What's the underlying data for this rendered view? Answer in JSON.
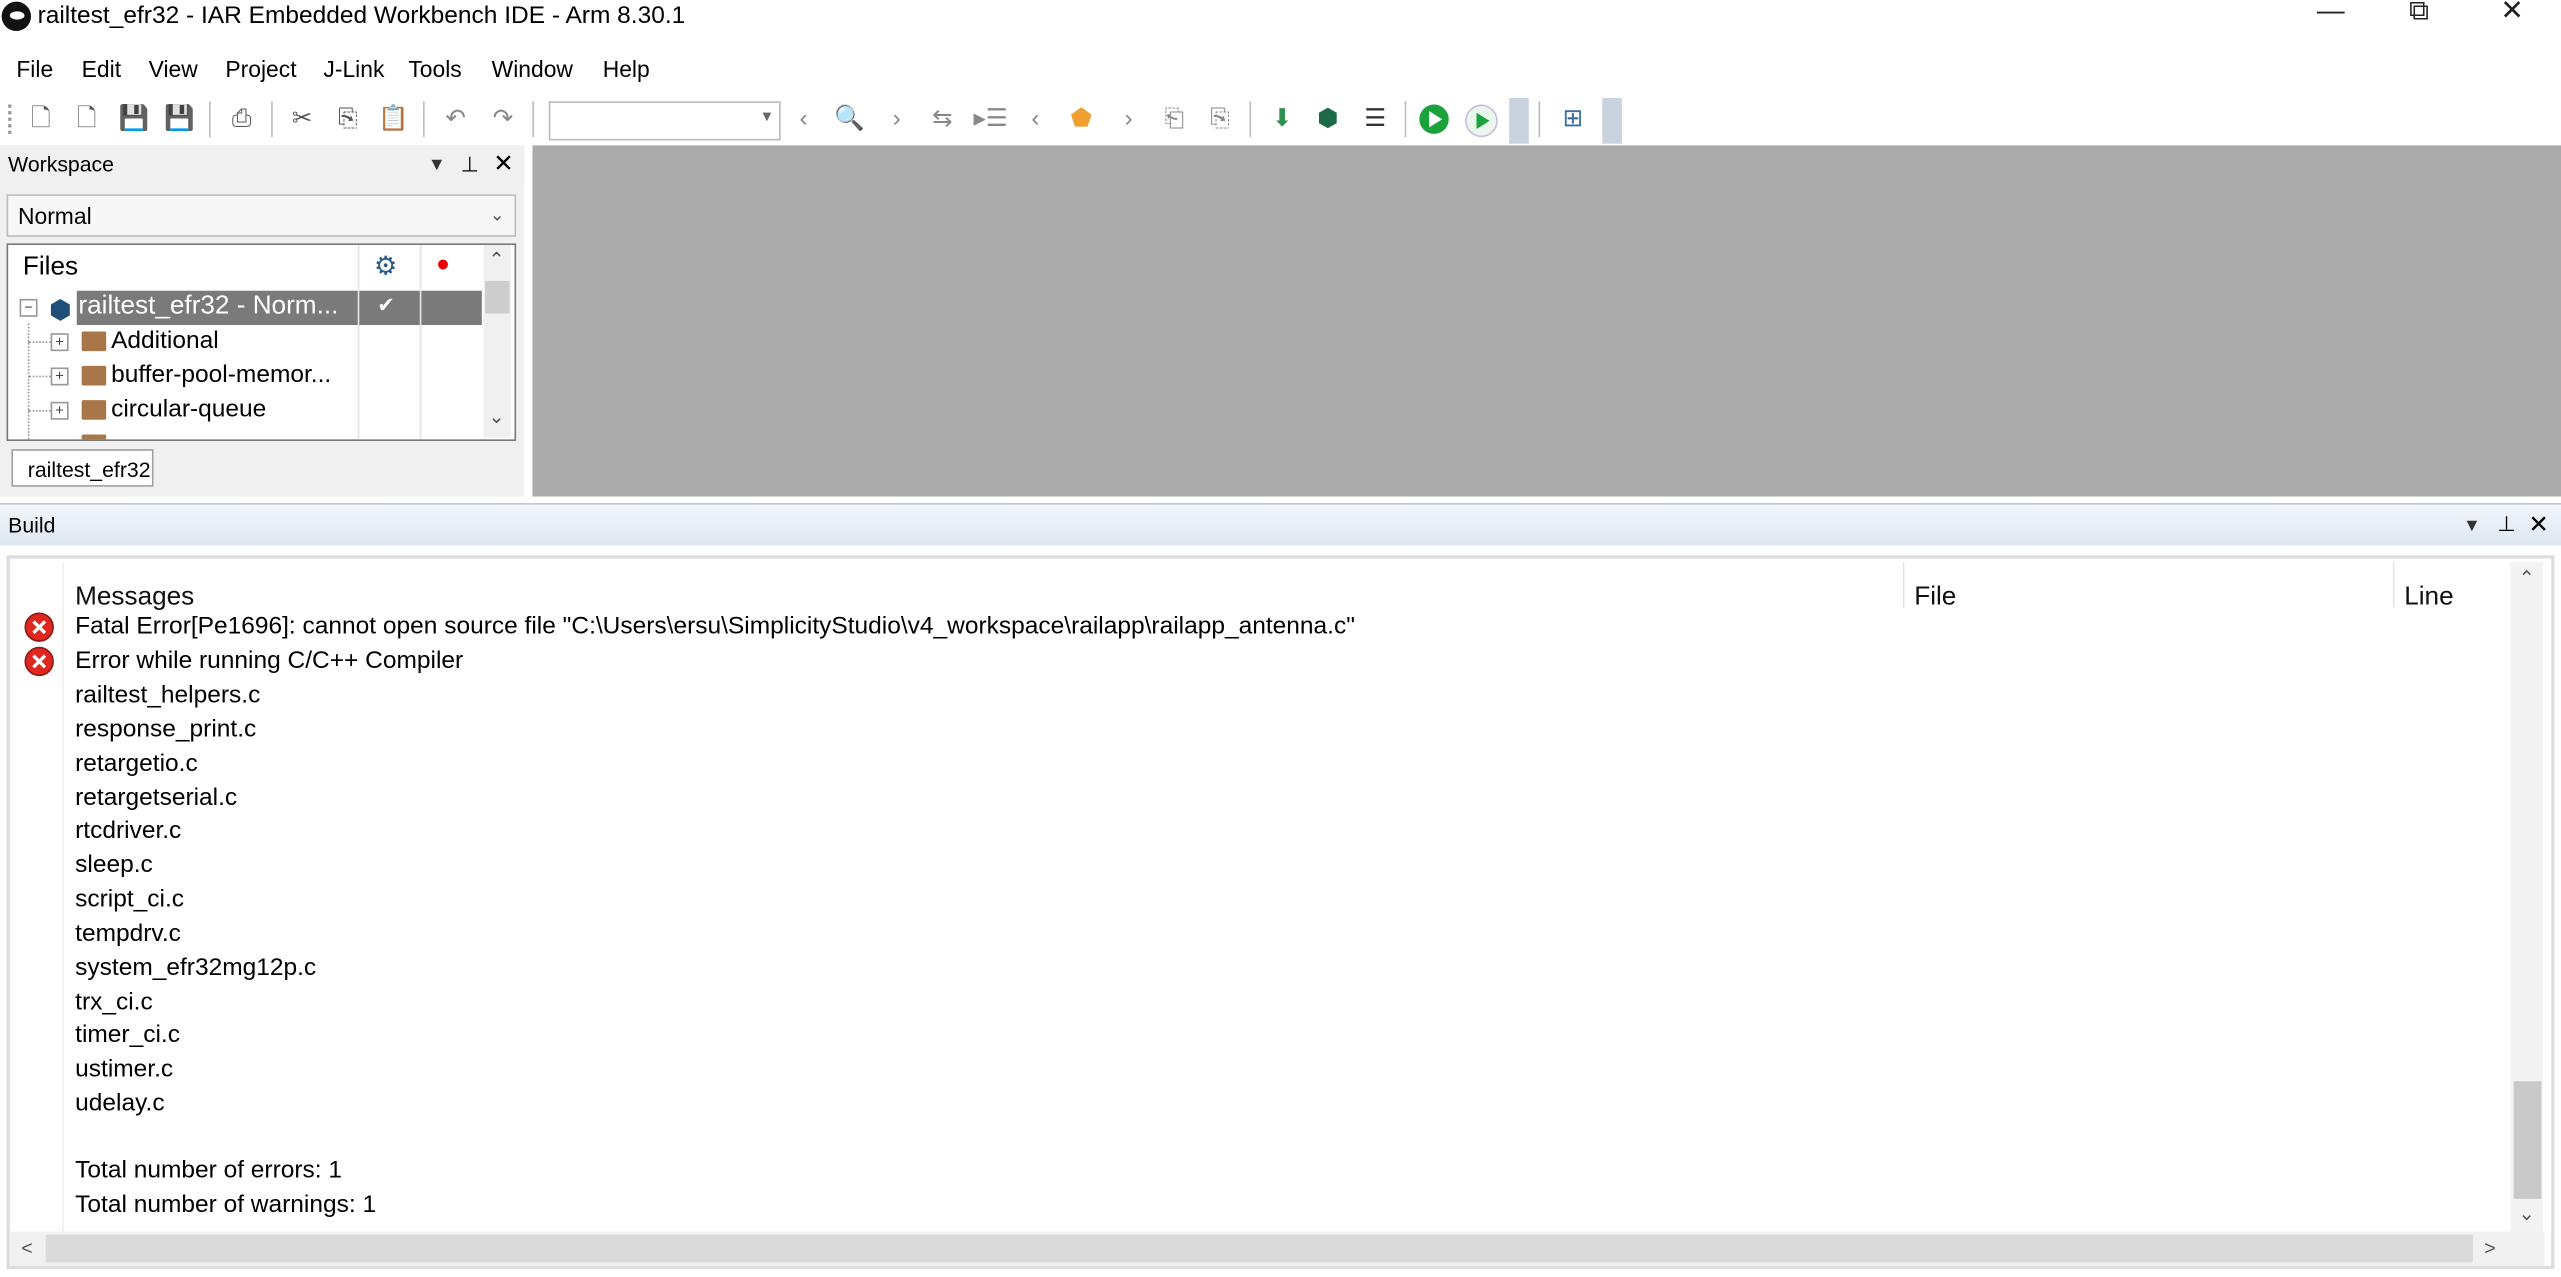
{
  "window": {
    "title": "railtest_efr32 - IAR Embedded Workbench IDE - Arm 8.30.1",
    "controls": {
      "minimize": "—",
      "maximize": "⧉",
      "close": "✕"
    }
  },
  "menu": {
    "items": [
      "File",
      "Edit",
      "View",
      "Project",
      "J-Link",
      "Tools",
      "Window",
      "Help"
    ]
  },
  "toolbar": {
    "search_combo_value": ""
  },
  "workspace": {
    "title": "Workspace",
    "configuration": "Normal",
    "tree_header": "Files",
    "project_node": "railtest_efr32 - Norm...",
    "folders": [
      "Additional",
      "buffer-pool-memor...",
      "circular-queue"
    ],
    "tab_label": "railtest_efr32"
  },
  "build": {
    "title": "Build",
    "columns": {
      "messages": "Messages",
      "file": "File",
      "line": "Line"
    },
    "errors": [
      "Fatal Error[Pe1696]: cannot open source file \"C:\\Users\\ersu\\SimplicityStudio\\v4_workspace\\railapp\\railapp_antenna.c\"",
      "Error while running C/C++ Compiler"
    ],
    "files": [
      "railtest_helpers.c",
      "response_print.c",
      "retargetio.c",
      "retargetserial.c",
      "rtcdriver.c",
      "sleep.c",
      "script_ci.c",
      "tempdrv.c",
      "system_efr32mg12p.c",
      "trx_ci.c",
      "timer_ci.c",
      "ustimer.c",
      "udelay.c"
    ],
    "summary": {
      "errors": "Total number of errors: 1",
      "warnings": "Total number of warnings: 1"
    }
  },
  "colors": {
    "error_red": "#e0271f",
    "selection": "#7a7a7a",
    "editor_bg": "#ababab",
    "run_green": "#19a33a"
  }
}
